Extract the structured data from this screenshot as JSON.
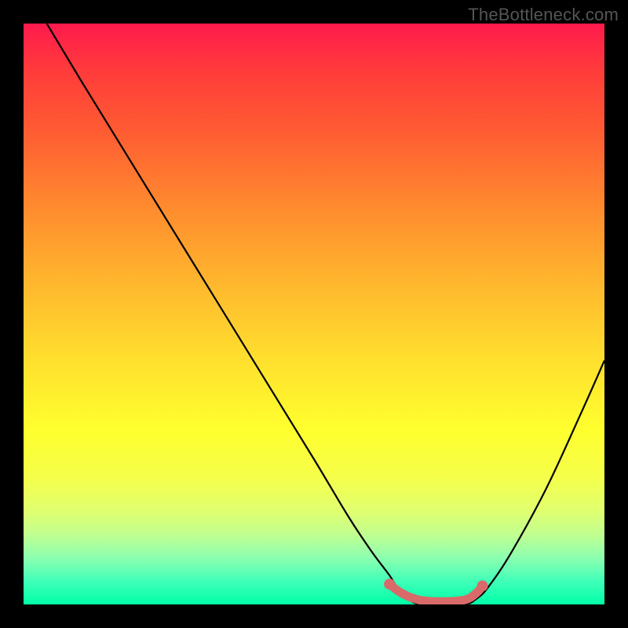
{
  "watermark": "TheBottleneck.com",
  "chart_data": {
    "type": "line",
    "title": "",
    "xlabel": "",
    "ylabel": "",
    "xlim": [
      0,
      100
    ],
    "ylim": [
      0,
      100
    ],
    "series": [
      {
        "name": "bottleneck-curve",
        "x": [
          4,
          10,
          18,
          26,
          34,
          42,
          50,
          56,
          60,
          63,
          65,
          68,
          72,
          76,
          78,
          80,
          84,
          90,
          96,
          100
        ],
        "values": [
          100,
          90,
          77,
          64,
          51,
          38,
          25,
          15,
          9,
          5,
          2,
          0,
          0,
          0,
          1,
          3,
          9,
          20,
          33,
          42
        ]
      },
      {
        "name": "optimal-range-marker",
        "x": [
          63,
          65,
          68,
          72,
          76,
          78,
          79
        ],
        "values": [
          3.5,
          2,
          0.8,
          0.5,
          0.8,
          2,
          3.2
        ]
      }
    ],
    "marker_endpoints": {
      "left": {
        "x": 63,
        "y": 3.5
      },
      "right": {
        "x": 79,
        "y": 3.2
      }
    },
    "gradient_stops": [
      {
        "pos": 0,
        "color": "#ff1a4d"
      },
      {
        "pos": 8,
        "color": "#ff3b3b"
      },
      {
        "pos": 18,
        "color": "#ff5a33"
      },
      {
        "pos": 32,
        "color": "#ff8c2e"
      },
      {
        "pos": 45,
        "color": "#ffb82e"
      },
      {
        "pos": 58,
        "color": "#ffe02e"
      },
      {
        "pos": 70,
        "color": "#ffff2e"
      },
      {
        "pos": 78,
        "color": "#f5ff4a"
      },
      {
        "pos": 84,
        "color": "#e0ff70"
      },
      {
        "pos": 88,
        "color": "#c0ff90"
      },
      {
        "pos": 92,
        "color": "#8cffb0"
      },
      {
        "pos": 96,
        "color": "#40ffb8"
      },
      {
        "pos": 100,
        "color": "#00ffa8"
      }
    ],
    "curve_color": "#000000",
    "marker_color": "#d96a6a"
  }
}
